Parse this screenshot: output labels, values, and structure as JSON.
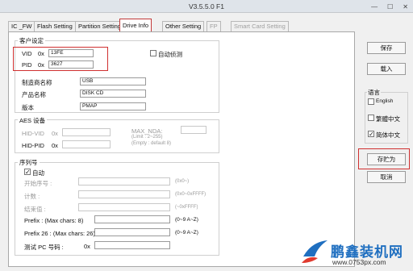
{
  "window": {
    "title": "V3.5.5.0 F1",
    "min": "—",
    "max": "☐",
    "close": "✕"
  },
  "tabs": [
    {
      "label": "IC _FW"
    },
    {
      "label": "Flash Setting"
    },
    {
      "label": "Partition Setting"
    },
    {
      "label": "Drive Info"
    },
    {
      "label": "Other Setting"
    },
    {
      "label": "FP"
    },
    {
      "label": "Smart Card Setting"
    }
  ],
  "customer": {
    "title": "客户设定",
    "vid_label": "VID",
    "vid_prefix": "0x",
    "vid_value": "13FE",
    "pid_label": "PID",
    "pid_prefix": "0x",
    "pid_value": "3627",
    "auto_detect": "自动侦测",
    "vendor_label": "制造商名称",
    "vendor_value": "USB",
    "product_label": "产品名称",
    "product_value": "DISK CD",
    "version_label": "版本",
    "version_value": "PMAP"
  },
  "aes": {
    "title": "AES 设备",
    "hidvid_label": "HID-VID",
    "hidvid_prefix": "0x",
    "hidpid_label": "HID-PID",
    "hidpid_prefix": "0x",
    "maxnda_label": "MAX_NDA:",
    "maxnda_hint1": "(Limit : 2~255)",
    "maxnda_hint2": "(Empty : default 8)"
  },
  "serial": {
    "title": "序列号",
    "auto_label": "自动",
    "start_label": "开始序号 :",
    "start_hint": "(0x0~)",
    "count_label": "计数 :",
    "count_hint": "(0x0~0xFFFF)",
    "end_label": "结束值 :",
    "end_hint": "(~0xFFFF)",
    "prefix_label": "Prefix : (Max chars: 8)",
    "prefix_hint": "(0~9 A~Z)",
    "prefix26_label": "Prefix 26 : (Max chars: 26)",
    "prefix26_hint": "(0~9 A~Z)",
    "pcid_label": "测试 PC 号码 :",
    "pcid_prefix": "0x"
  },
  "sidebar": {
    "save": "保存",
    "load": "载入",
    "language_title": "语言",
    "lang_english": "English",
    "lang_trad": "繁體中文",
    "lang_simp": "简体中文",
    "save_as": "存贮为",
    "cancel": "取消"
  },
  "watermark": {
    "brand": "鹏鑫装机网",
    "url": "www.0753px.com"
  }
}
